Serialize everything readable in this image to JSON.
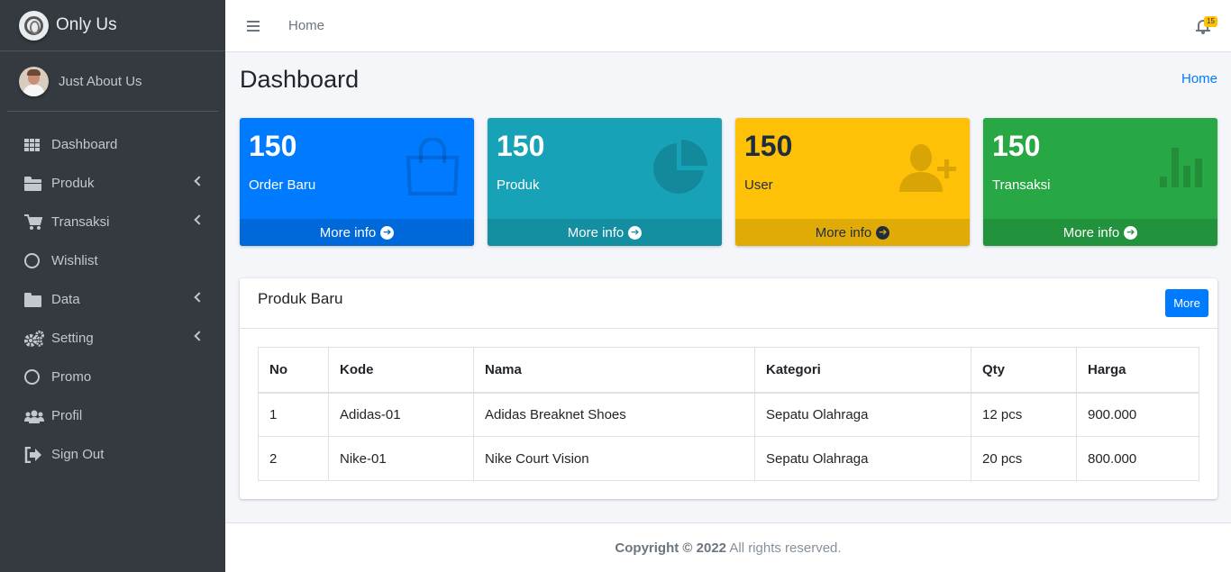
{
  "brand": {
    "name": "Only Us"
  },
  "user": {
    "name": "Just About Us"
  },
  "sidebar": {
    "items": [
      {
        "label": "Dashboard",
        "icon": "grid-icon"
      },
      {
        "label": "Produk",
        "icon": "folder-open-icon",
        "has_submenu": true
      },
      {
        "label": "Transaksi",
        "icon": "cart-icon",
        "has_submenu": true
      },
      {
        "label": "Wishlist",
        "icon": "circle-icon"
      },
      {
        "label": "Data",
        "icon": "folder-icon",
        "has_submenu": true
      },
      {
        "label": "Setting",
        "icon": "gears-icon",
        "has_submenu": true
      },
      {
        "label": "Promo",
        "icon": "circle-icon"
      },
      {
        "label": "Profil",
        "icon": "users-icon"
      },
      {
        "label": "Sign Out",
        "icon": "sign-out-icon"
      }
    ]
  },
  "topbar": {
    "home_link": "Home",
    "notification_count": "15"
  },
  "page": {
    "title": "Dashboard",
    "breadcrumb": "Home"
  },
  "stats": [
    {
      "value": "150",
      "label": "Order Baru",
      "link": "More info",
      "icon": "shopping-bag-icon",
      "color": "#007bff"
    },
    {
      "value": "150",
      "label": "Produk",
      "link": "More info",
      "icon": "pie-chart-icon",
      "color": "#17a2b8"
    },
    {
      "value": "150",
      "label": "User",
      "link": "More info",
      "icon": "user-plus-icon",
      "color": "#ffc107"
    },
    {
      "value": "150",
      "label": "Transaksi",
      "link": "More info",
      "icon": "bar-chart-icon",
      "color": "#28a745"
    }
  ],
  "card": {
    "title": "Produk Baru",
    "more_label": "More",
    "columns": [
      "No",
      "Kode",
      "Nama",
      "Kategori",
      "Qty",
      "Harga"
    ],
    "rows": [
      [
        "1",
        "Adidas-01",
        "Adidas Breaknet Shoes",
        "Sepatu Olahraga",
        "12 pcs",
        "900.000"
      ],
      [
        "2",
        "Nike-01",
        "Nike Court Vision",
        "Sepatu Olahraga",
        "20 pcs",
        "800.000"
      ]
    ]
  },
  "footer": {
    "copyright": "Copyright © 2022",
    "rights": " All rights reserved."
  }
}
